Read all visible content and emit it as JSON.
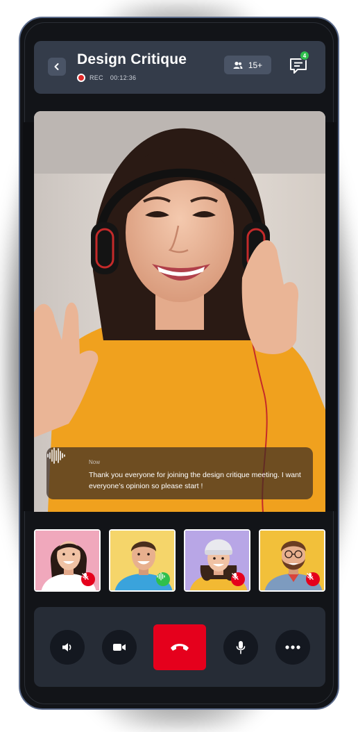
{
  "header": {
    "title": "Design Critique",
    "rec_label": "REC",
    "rec_time": "00:12:36",
    "participants_count": "15+",
    "chat_badge": "4"
  },
  "caption": {
    "time": "Now",
    "text": "Thank you everyone for joining the design critique meeting. I want everyone’s opinion so please start !"
  },
  "participants": [
    {
      "mic": "muted",
      "bg": "#f0a8bc"
    },
    {
      "mic": "active",
      "bg": "#f5d56a"
    },
    {
      "mic": "muted",
      "bg": "#b8a6e6"
    },
    {
      "mic": "muted",
      "bg": "#f2c03a"
    }
  ],
  "controls": {
    "icons": [
      "speaker-icon",
      "video-camera-icon",
      "end-call-icon",
      "microphone-icon",
      "more-options-icon"
    ]
  },
  "colors": {
    "end_call": "#e5001c",
    "muted": "#e5001c",
    "active_mic": "#2fbf4c",
    "header_bg": "#343c4a"
  }
}
